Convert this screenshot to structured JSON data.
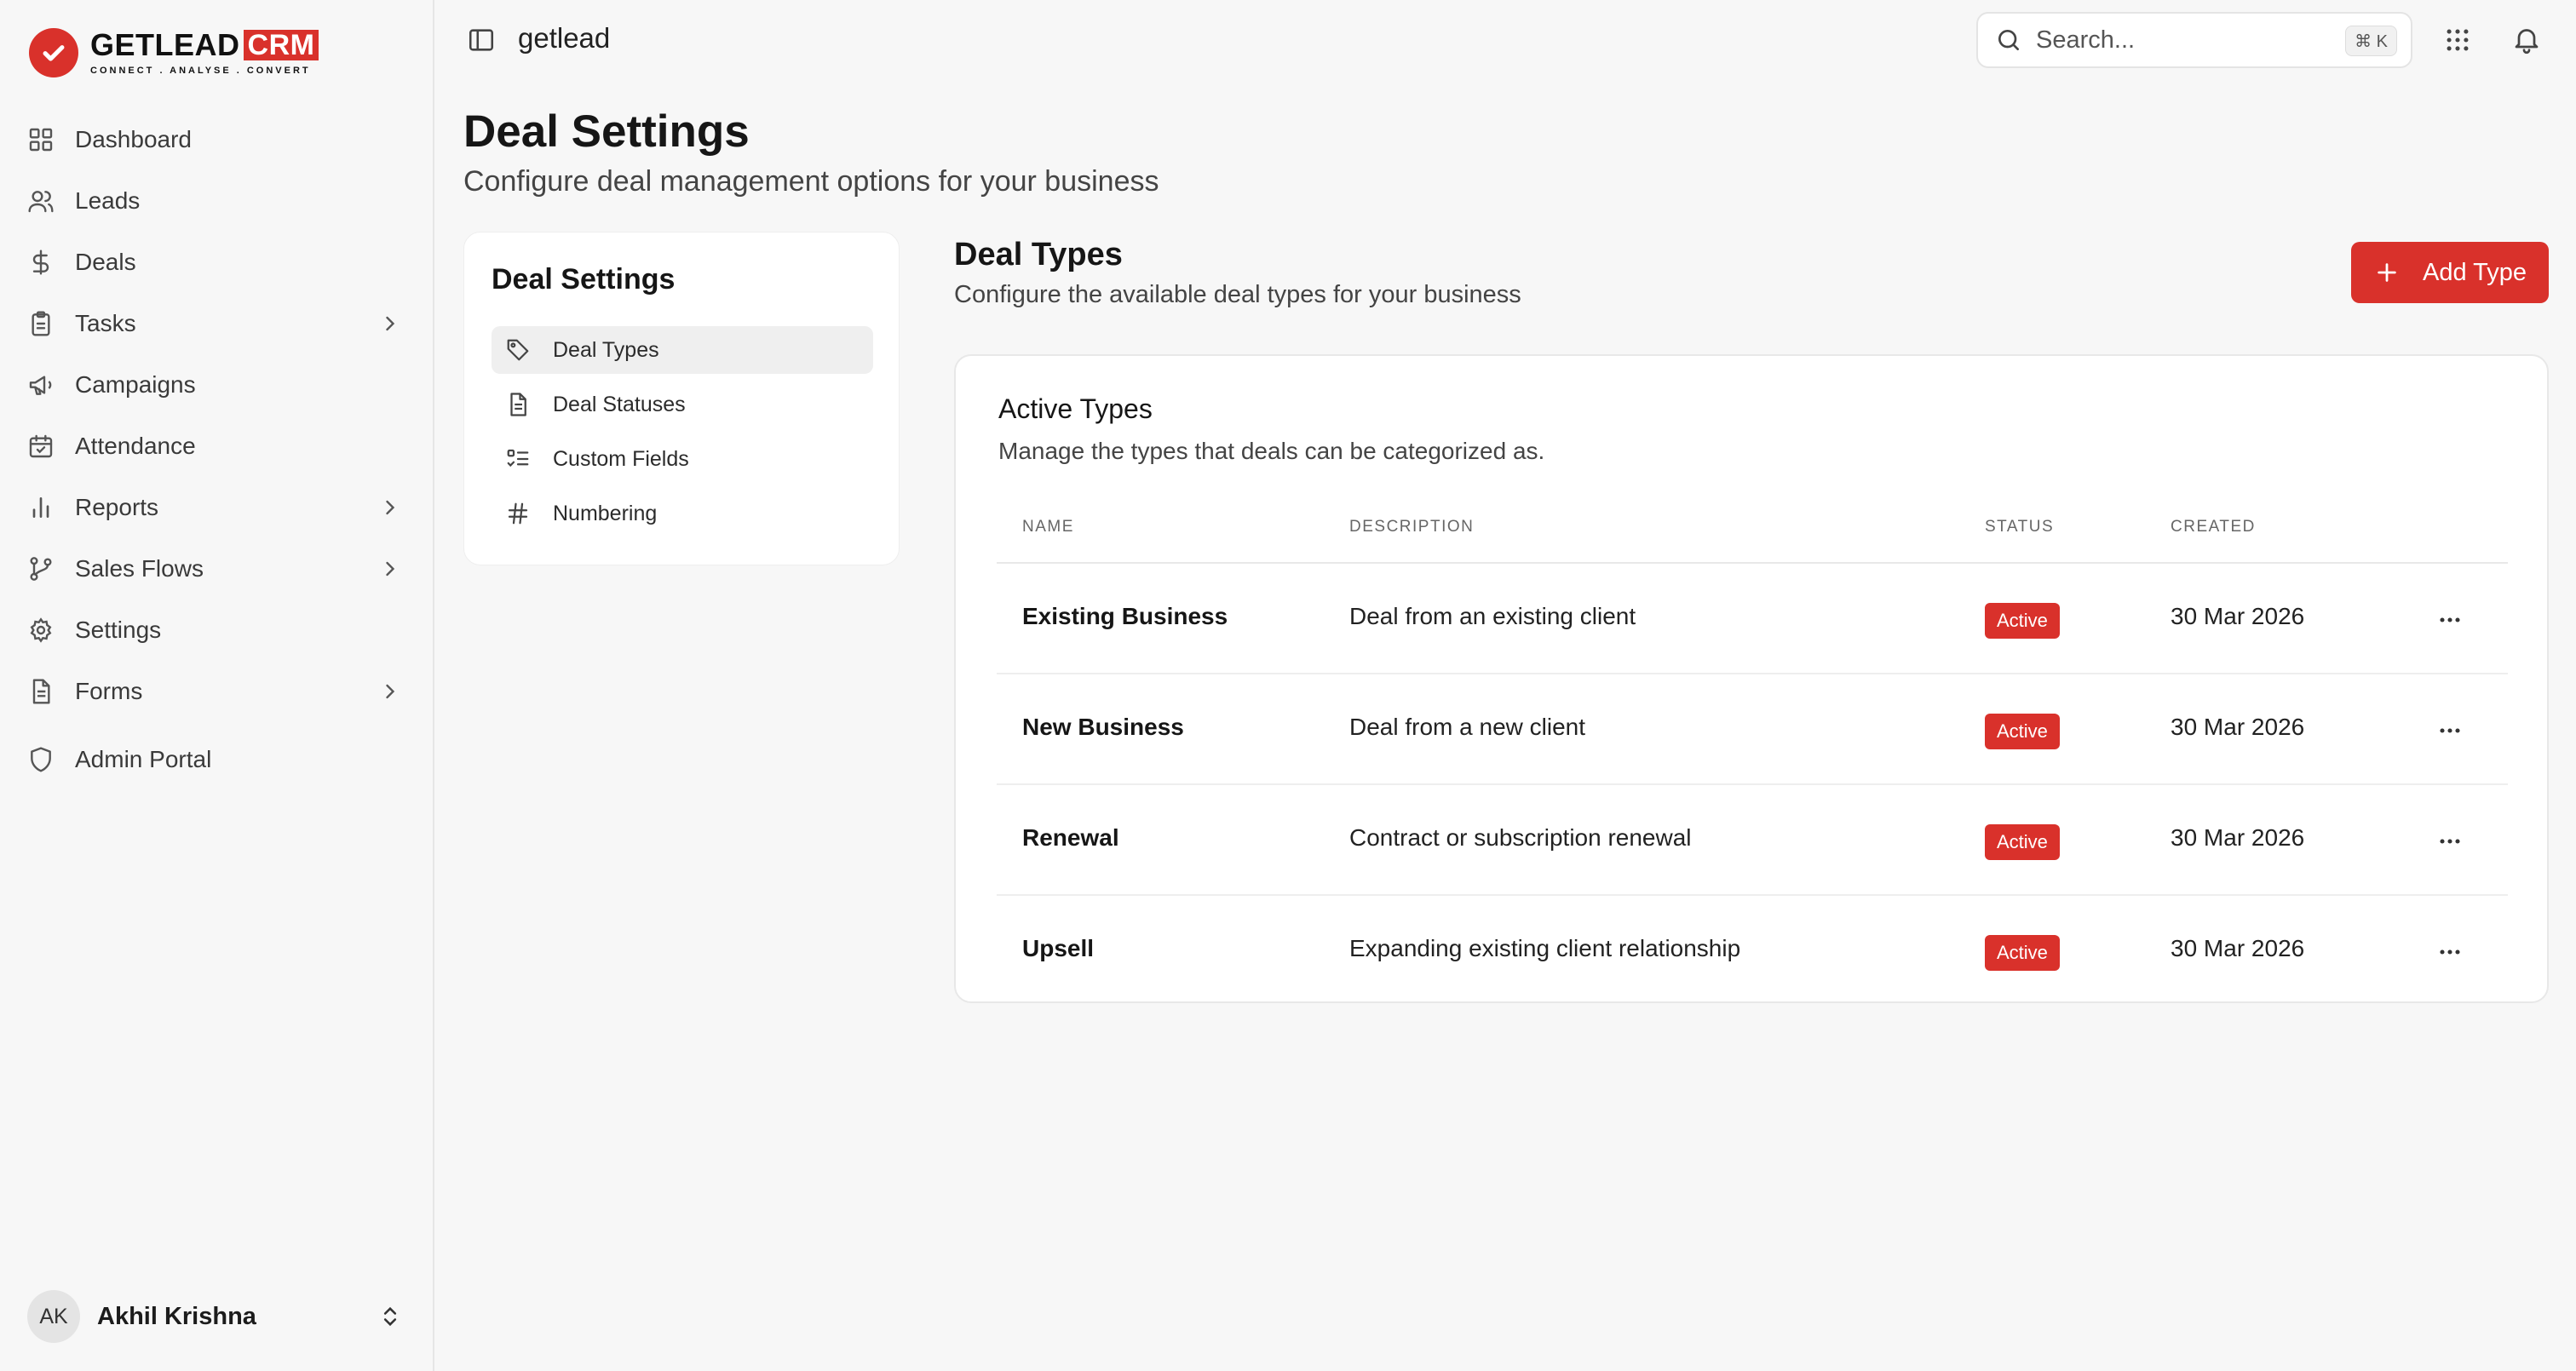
{
  "colors": {
    "accent": "#d9312b",
    "background": "#f7f7f7",
    "card": "#ffffff"
  },
  "logo": {
    "word": "GETLEAD",
    "crm": "CRM",
    "tagline": "CONNECT . ANALYSE . CONVERT"
  },
  "sidebar": {
    "items": [
      {
        "label": "Dashboard",
        "icon": "layout-grid-icon",
        "has_submenu": false
      },
      {
        "label": "Leads",
        "icon": "users-icon",
        "has_submenu": false
      },
      {
        "label": "Deals",
        "icon": "dollar-icon",
        "has_submenu": false
      },
      {
        "label": "Tasks",
        "icon": "clipboard-icon",
        "has_submenu": true
      },
      {
        "label": "Campaigns",
        "icon": "megaphone-icon",
        "has_submenu": false
      },
      {
        "label": "Attendance",
        "icon": "calendar-check-icon",
        "has_submenu": false
      },
      {
        "label": "Reports",
        "icon": "bar-chart-icon",
        "has_submenu": true
      },
      {
        "label": "Sales Flows",
        "icon": "git-branch-icon",
        "has_submenu": true
      },
      {
        "label": "Settings",
        "icon": "gear-icon",
        "has_submenu": false
      },
      {
        "label": "Forms",
        "icon": "file-text-icon",
        "has_submenu": true
      }
    ],
    "admin": {
      "label": "Admin Portal",
      "icon": "shield-icon"
    },
    "user": {
      "initials": "AK",
      "name": "Akhil Krishna"
    }
  },
  "topbar": {
    "workspace": "getlead",
    "search": {
      "placeholder": "Search...",
      "shortcut": "⌘ K"
    }
  },
  "page": {
    "title": "Deal Settings",
    "subtitle": "Configure deal management options for your business"
  },
  "settings_menu": {
    "title": "Deal Settings",
    "items": [
      {
        "label": "Deal Types",
        "icon": "tag-icon",
        "active": true
      },
      {
        "label": "Deal Statuses",
        "icon": "file-icon",
        "active": false
      },
      {
        "label": "Custom Fields",
        "icon": "list-checks-icon",
        "active": false
      },
      {
        "label": "Numbering",
        "icon": "hash-icon",
        "active": false
      }
    ]
  },
  "content": {
    "title": "Deal Types",
    "subtitle": "Configure the available deal types for your business",
    "add_button": "Add Type",
    "card": {
      "title": "Active Types",
      "subtitle": "Manage the types that deals can be categorized as.",
      "columns": [
        "NAME",
        "DESCRIPTION",
        "STATUS",
        "CREATED"
      ],
      "rows": [
        {
          "name": "Existing Business",
          "description": "Deal from an existing client",
          "status": "Active",
          "created": "30 Mar 2026"
        },
        {
          "name": "New Business",
          "description": "Deal from a new client",
          "status": "Active",
          "created": "30 Mar 2026"
        },
        {
          "name": "Renewal",
          "description": "Contract or subscription renewal",
          "status": "Active",
          "created": "30 Mar 2026"
        },
        {
          "name": "Upsell",
          "description": "Expanding existing client relationship",
          "status": "Active",
          "created": "30 Mar 2026"
        }
      ]
    }
  }
}
